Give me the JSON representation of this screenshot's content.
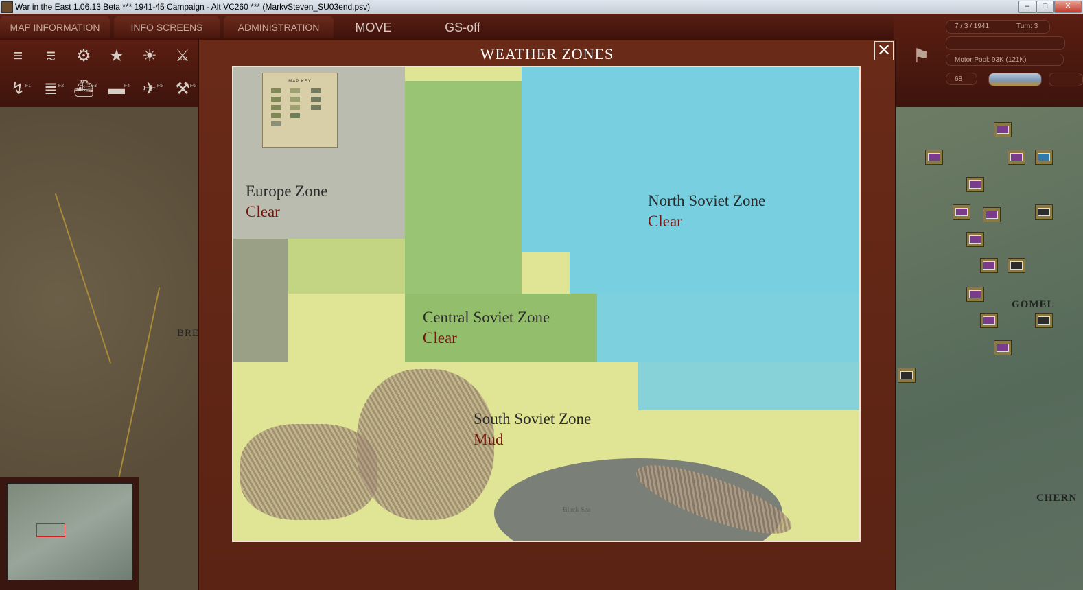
{
  "window": {
    "title": "War in the East 1.06.13 Beta            ***   1941-45 Campaign - Alt VC260   ***   (MarkvSteven_SU03end.psv)",
    "controls": [
      "–",
      "□",
      "✕"
    ]
  },
  "menu": {
    "tabs": [
      "MAP INFORMATION",
      "INFO SCREENS",
      "ADMINISTRATION"
    ],
    "move": "MOVE",
    "gs": "GS-off"
  },
  "toolbar": {
    "row1": [
      {
        "icon": "unit-stack-icon",
        "glyph": "≡"
      },
      {
        "icon": "sliders-icon",
        "glyph": "⩳"
      },
      {
        "icon": "gear-icon",
        "glyph": "⚙"
      },
      {
        "icon": "star-icon",
        "glyph": "★"
      },
      {
        "icon": "weather-map-icon",
        "glyph": "☀"
      },
      {
        "icon": "crossed-swords-icon",
        "glyph": "⚔"
      }
    ],
    "row2": [
      {
        "icon": "supply-path-icon",
        "glyph": "↯",
        "key": "F1"
      },
      {
        "icon": "rail-icon",
        "glyph": "≣",
        "key": "F2"
      },
      {
        "icon": "ship-icon",
        "glyph": "⛴",
        "key": "F3"
      },
      {
        "icon": "naval-icon",
        "glyph": "▬",
        "key": "F4"
      },
      {
        "icon": "air-icon",
        "glyph": "✈",
        "key": "F5"
      },
      {
        "icon": "engineer-icon",
        "glyph": "⚒",
        "key": "F6"
      }
    ]
  },
  "status": {
    "date": "7 / 3 / 1941",
    "turn": "Turn: 3",
    "motor_pool": "Motor Pool:  93K (121K)",
    "value": "68"
  },
  "map": {
    "left_label": "BRE",
    "right_labels": [
      "GOMEL",
      "CHERN"
    ]
  },
  "dialog": {
    "title": "WEATHER ZONES",
    "close": "✕",
    "zones": [
      {
        "name": "Europe Zone",
        "condition": "Clear"
      },
      {
        "name": "North Soviet Zone",
        "condition": "Clear"
      },
      {
        "name": "Central Soviet Zone",
        "condition": "Clear"
      },
      {
        "name": "South Soviet Zone",
        "condition": "Mud"
      }
    ],
    "map_key_title": "MAP KEY",
    "sea_label": "Black Sea"
  },
  "colors": {
    "europe": "#b8b8b8",
    "north": "#6fd4e6",
    "central": "#8ec070",
    "south": "#e6ec8c",
    "condition": "#7a1410",
    "frame": "#6a2a18"
  }
}
